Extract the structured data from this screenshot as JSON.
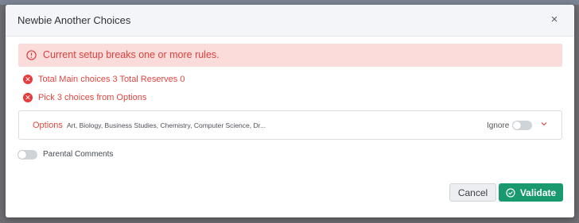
{
  "modal": {
    "title": "Newbie Another Choices",
    "close_glyph": "×"
  },
  "alert": {
    "icon": "info-circle-icon",
    "message": "Current setup breaks one or more rules."
  },
  "errors": [
    {
      "icon": "error-x-icon",
      "text": "Total Main choices 3 Total Reserves 0"
    },
    {
      "icon": "error-x-icon",
      "text": "Pick 3 choices from Options"
    }
  ],
  "options": {
    "label": "Options",
    "list": "Art, Biology, Business Studies, Chemistry, Computer Science, Dr...",
    "ignore_label": "Ignore",
    "ignore_on": false
  },
  "parental": {
    "label": "Parental Comments",
    "on": false
  },
  "footer": {
    "cancel_label": "Cancel",
    "validate_label": "Validate"
  },
  "colors": {
    "alert_bg": "#fbdcda",
    "error_red": "#e0453f",
    "validate_green": "#18996e"
  }
}
